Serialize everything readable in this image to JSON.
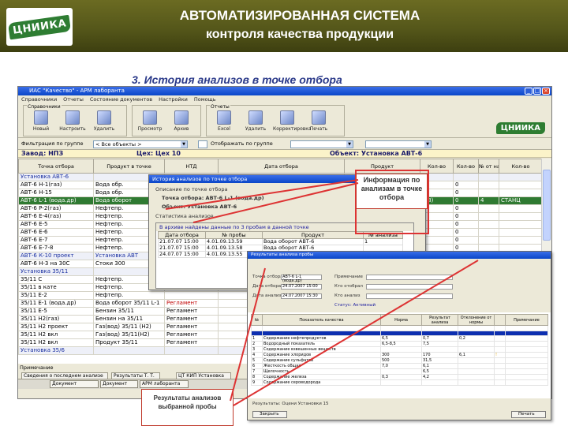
{
  "slide": {
    "title": "АВТОМАТИЗИРОВАННАЯ СИСТЕМА",
    "subtitle": "контроля качества продукции",
    "section": "3. История анализов в точке отбора",
    "logo": "ЦНИИКА"
  },
  "app": {
    "window_title": "ИАС \"Качество\" - АРМ лаборанта",
    "menu": [
      "Справочники",
      "Отчеты",
      "Состояние документов",
      "Настройки",
      "Помощь"
    ],
    "toolbar_groups": [
      {
        "label": "Справочники",
        "tools": [
          "Новый",
          "Настроить",
          "Удалить"
        ]
      },
      {
        "label": "",
        "tools": [
          "Просмотр",
          "Архив"
        ]
      },
      {
        "label": "Отчеты",
        "tools": [
          "Excel",
          "Удалить",
          "Корректировка",
          "Печать"
        ]
      }
    ],
    "logo": "ЦНИИКА",
    "filter": {
      "label": "Фильтрация по группе",
      "value": "< Все объекты >",
      "checkbox": "Отображать по группе"
    },
    "info": {
      "factory": "Завод: НПЗ",
      "shop": "Цех: Цех 10",
      "object": "Объект: Установка АВТ-6"
    },
    "columns": [
      "Точка отбора",
      "Продукт в точке",
      "НТД",
      "Дата отбора",
      "Продукт",
      "Кол-во",
      "Кол-во",
      "№ от на",
      "Кол-во"
    ],
    "rows": [
      {
        "kind": "group",
        "point": "Установка АВТ-6",
        "product": "",
        "ntd": "",
        "date": "",
        "prod": "",
        "c1": "",
        "c2": "",
        "c3": "",
        "c4": ""
      },
      {
        "kind": "row",
        "point": "АВТ-6 Н-1(газ)",
        "product": "Вода обр.",
        "ntd": "",
        "date": "",
        "prod": "",
        "c1": "",
        "c2": "0",
        "c3": "",
        "c4": ""
      },
      {
        "kind": "row",
        "point": "АВТ-6 Н-15",
        "product": "Вода обр.",
        "ntd": "",
        "date": "",
        "prod": "",
        "c1": "",
        "c2": "0",
        "c3": "",
        "c4": ""
      },
      {
        "kind": "sel",
        "point": "АВТ-6 L-1 (вода.др)",
        "product": "Вода оборот",
        "ntd": "",
        "date": "",
        "prod": "",
        "c1": "2(8)",
        "c2": "0",
        "c3": "4",
        "c4": "СТАНЦ"
      },
      {
        "kind": "row",
        "point": "АВТ-6 Р-2(газ)",
        "product": "Нефтепр.",
        "ntd": "",
        "date": "",
        "prod": "",
        "c1": "",
        "c2": "0",
        "c3": "",
        "c4": ""
      },
      {
        "kind": "row",
        "point": "АВТ-6 Е-4(газ)",
        "product": "Нефтепр.",
        "ntd": "",
        "date": "",
        "prod": "",
        "c1": "",
        "c2": "0",
        "c3": "",
        "c4": ""
      },
      {
        "kind": "row",
        "point": "АВТ-6 Е-5",
        "product": "Нефтепр.",
        "ntd": "",
        "date": "",
        "prod": "",
        "c1": "",
        "c2": "0",
        "c3": "",
        "c4": ""
      },
      {
        "kind": "row",
        "point": "АВТ-6 Е-6",
        "product": "Нефтепр.",
        "ntd": "",
        "date": "",
        "prod": "",
        "c1": "",
        "c2": "0",
        "c3": "",
        "c4": ""
      },
      {
        "kind": "row",
        "point": "АВТ-6 Е-7",
        "product": "Нефтепр.",
        "ntd": "",
        "date": "",
        "prod": "",
        "c1": "",
        "c2": "0",
        "c3": "",
        "c4": ""
      },
      {
        "kind": "row",
        "point": "АВТ-6 Е-7-8",
        "product": "Нефтепр.",
        "ntd": "",
        "date": "",
        "prod": "",
        "c1": "",
        "c2": "0",
        "c3": "",
        "c4": ""
      },
      {
        "kind": "group",
        "point": "АВТ-6 К-10 проект",
        "product": "Установка АВТ",
        "ntd": "",
        "date": "",
        "prod": "",
        "c1": "",
        "c2": "",
        "c3": "",
        "c4": ""
      },
      {
        "kind": "row",
        "point": "АВТ-6 Н-3 на 30С",
        "product": "Стоки 300",
        "ntd": "",
        "date": "",
        "prod": "",
        "c1": "",
        "c2": "0",
        "c3": "",
        "c4": ""
      },
      {
        "kind": "group",
        "point": "Установка 35/11",
        "product": "",
        "ntd": "",
        "date": "",
        "prod": "",
        "c1": "",
        "c2": "",
        "c3": "",
        "c4": ""
      },
      {
        "kind": "row",
        "point": "35/11 С",
        "product": "Нефтепр.",
        "ntd": "",
        "date": "",
        "prod": "",
        "c1": "",
        "c2": "0",
        "c3": "",
        "c4": ""
      },
      {
        "kind": "row",
        "point": "35/11 в кате",
        "product": "Нефтепр.",
        "ntd": "",
        "date": "",
        "prod": "",
        "c1": "",
        "c2": "0",
        "c3": "",
        "c4": ""
      },
      {
        "kind": "row",
        "point": "35/11 Е-2",
        "product": "Нефтепр.",
        "ntd": "",
        "date": "",
        "prod": "",
        "c1": "",
        "c2": "0",
        "c3": "",
        "c4": ""
      },
      {
        "kind": "red",
        "point": "35/11 Е-1 (вода.др)",
        "product": "Вода оборот 35/11 L-1",
        "ntd": "Регламент",
        "date": "",
        "prod": "",
        "c1": "",
        "c2": "",
        "c3": "",
        "c4": ""
      },
      {
        "kind": "row",
        "point": "35/11 Е-5",
        "product": "Бензин 35/11",
        "ntd": "Регламент",
        "date": "",
        "prod": "",
        "c1": "",
        "c2": "",
        "c3": "",
        "c4": ""
      },
      {
        "kind": "row",
        "point": "35/11 Н2(газ)",
        "product": "Бензин на 35/11",
        "ntd": "Регламент",
        "date": "",
        "prod": "",
        "c1": "",
        "c2": "",
        "c3": "",
        "c4": ""
      },
      {
        "kind": "row",
        "point": "35/11 Н2 проект",
        "product": "Газ(вод) 35/11 (Н2)",
        "ntd": "Регламент",
        "date": "",
        "prod": "",
        "c1": "",
        "c2": "",
        "c3": "",
        "c4": ""
      },
      {
        "kind": "row",
        "point": "35/11 Н2 вкл",
        "product": "Газ(вод) 35/11(Н2)",
        "ntd": "Регламент",
        "date": "",
        "prod": "",
        "c1": "",
        "c2": "",
        "c3": "",
        "c4": ""
      },
      {
        "kind": "row",
        "point": "35/11 Н2 вкл",
        "product": "Продукт 35/11",
        "ntd": "Регламент",
        "date": "",
        "prod": "",
        "c1": "",
        "c2": "",
        "c3": "",
        "c4": ""
      },
      {
        "kind": "group",
        "point": "Установка 35/6",
        "product": "",
        "ntd": "",
        "date": "",
        "prod": "",
        "c1": "",
        "c2": "",
        "c3": "",
        "c4": ""
      }
    ],
    "bottom": {
      "label": "Примечание",
      "tabs": [
        "Сведения о последнем анализе",
        "Результаты Т. Т.",
        "ЦТ КИП Установка"
      ]
    },
    "taskbar": [
      "Документ",
      "Документ",
      "АРМ лаборанта"
    ]
  },
  "dialog1": {
    "title": "История анализов по точке отбора",
    "lines": [
      "Описание по точке отбора",
      "Точка отбора: АВТ-6 L-1 (вода.др)",
      "Объект: Установка АВТ-6",
      "Статистика анализов"
    ],
    "note": "В архиве найдены данные по 3 пробам в данной точке",
    "columns": [
      "Дата отбора",
      "№ пробы",
      "Продукт",
      "№ анализа"
    ],
    "rows": [
      [
        "21.07.07 15:00",
        "4.01.09.13.59",
        "Вода оборот АВТ-6",
        "1"
      ],
      [
        "21.07.07 15:00",
        "4.01.09.13.58",
        "Вода оборот АВТ-6",
        ""
      ],
      [
        "24.07.07 15:00",
        "4.01.09.13.55",
        "Вода оборот АВТ-6",
        ""
      ]
    ]
  },
  "callout1": "Информация по анализам в точке отбора",
  "dialog2": {
    "title": "Результаты анализа пробы",
    "fields": [
      {
        "label": "Точка отбора",
        "value": "АВТ-6 L-1 (вода.др)"
      },
      {
        "label": "Дата отбора",
        "value": "24.07.2007 15:00"
      },
      {
        "label": "Дата анализа",
        "value": "24.07.2007 15:30"
      }
    ],
    "right_fields": [
      "Примечание",
      "Кто отобрал",
      "Кто анализ",
      "Статус: Активный"
    ],
    "columns": [
      "№",
      "Показатель качества",
      "Норма",
      "Результат анализа",
      "Отклонение от нормы",
      "",
      "Примечание"
    ],
    "rows": [
      [
        "",
        "",
        "",
        "",
        "",
        "",
        ""
      ],
      [
        "",
        "",
        "",
        "",
        "",
        "",
        ""
      ],
      [
        "1",
        "Содержание нефтепродуктов",
        "6,5",
        "0,7",
        "0,2",
        "",
        ""
      ],
      [
        "2",
        "Водородный показатель",
        "6,5-8,5",
        "7,5",
        "",
        "",
        ""
      ],
      [
        "3",
        "Содержание взвешенных веществ",
        "",
        "",
        "",
        "",
        ""
      ],
      [
        "4",
        "Содержание хлоридов",
        "300",
        "170",
        "6,1",
        "!",
        ""
      ],
      [
        "5",
        "Содержание сульфатов",
        "500",
        "31,5",
        "",
        "",
        ""
      ],
      [
        "6",
        "Жесткость общая",
        "7,0",
        "6,1",
        "",
        "",
        ""
      ],
      [
        "7",
        "Щелочность",
        "",
        "6,5",
        "",
        "",
        ""
      ],
      [
        "8",
        "Содержание железа",
        "0,3",
        "4,2",
        "",
        "",
        ""
      ],
      [
        "9",
        "Содержание сероводорода",
        "",
        "",
        "",
        "",
        ""
      ]
    ],
    "footer": {
      "label": "Результаты: Оцени Установки 15",
      "ok": "Закрыть",
      "print": "Печать"
    }
  },
  "callout2": "Результаты анализов выбранной пробы",
  "colors": {
    "header_bg": "#55571a",
    "selection": "#2f7a32",
    "accent": "#d33333"
  }
}
